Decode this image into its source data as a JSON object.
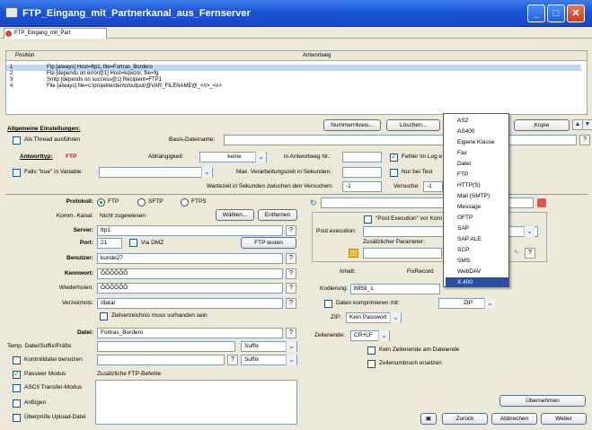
{
  "window": {
    "title": "FTP_Eingang_mit_Partnerkanal_aus_Fernserver",
    "tab": "FTP_Eingang_mit_Part"
  },
  "table": {
    "col_position": "Position",
    "col_antwortweg": "Antwortweg",
    "rows": [
      {
        "pos": "1",
        "text": "Ftp [always] Host=ftp1, file=Fortras_Bordero"
      },
      {
        "pos": "2",
        "text": "Ftp [depends on error@1] Host=kqwzor, file=fg"
      },
      {
        "pos": "3",
        "text": "Smtp [depends on success@1] Recipient=FTP1"
      },
      {
        "pos": "4",
        "text": "File [always] file=c:/projekte/demo/output/@VAR_FILENAME@_<n>_<n>"
      }
    ]
  },
  "toolbar": {
    "nummernkreis": "Nummernkreis...",
    "loeschen": "Löschen...",
    "kopie": "Kopie",
    "up": "▲",
    "down": "▼"
  },
  "allgemein": {
    "heading": "Allgemeine Einstellungen:",
    "thread": "Als Thread ausführen",
    "basis": "Basis-Dateiname:",
    "q": "?"
  },
  "antwort": {
    "label": "Antworttyp:",
    "value": "FTP",
    "abh_label": "Abhängigkeit:",
    "abh_value": "keine",
    "nr_label": "in Antwortweg Nr.:",
    "fehler": "Fehler im Log e",
    "falls": "Falls \"true\" in Variable:",
    "max_label": "Max. Verarbeitungszeit in Sekunden:",
    "nurtest": "Nur bei Test",
    "warte_label": "Wartezeit in Sekunden zwischen den Versuchen:",
    "warte_value": "-1",
    "versuche_label": "Versuche:",
    "versuche_value": "-1"
  },
  "ftp": {
    "protokoll": "Protokoll:",
    "ftp": "FTP",
    "sftp": "SFTP",
    "ftps": "FTPS",
    "kanal_label": "Komm.-Kanal:",
    "kanal_value": "Nicht zugewiesen",
    "waehlen": "Wählen...",
    "entfernen": "Entfernen",
    "server_label": "Server:",
    "server": "ftp1",
    "port_label": "Port:",
    "port": "21",
    "viadmz": "Via DMZ",
    "testen": "FTP testen",
    "benutzer_label": "Benutzer:",
    "benutzer": "kunde27",
    "kennwort_label": "Kennwort:",
    "kennwort": "ÕÕÕÕÕÕ",
    "wiederholen_label": "Wiederholen:",
    "wiederholen": "ÕÕÕÕÕÕ",
    "verz_label": "Verzeichnis:",
    "verz": "/data/",
    "zielverz": "Zielverzeichnis muss vorhanden sein",
    "datei_label": "Datei:",
    "datei": "Fortras_Bordero",
    "temp_label": "Temp. Datei/Suffix/Präfix:",
    "suffix1": "Suffix",
    "kontroll": "Kontrolldatei benutzen",
    "suffix2": "Suffix",
    "passiv": "Passiver Modus",
    "zusatz": "Zusätzliche FTP-Befehle",
    "ascii": "ASCII Transfer-Modus",
    "anfuegen": "Anfügen",
    "ueberpruefe": "Überprüfe Upload-Datei"
  },
  "right": {
    "postexec_cb": "\"Post Execution\" vor Kom",
    "postexec_label": "Post execution:",
    "zusatzparam": "Zusätzlicher Parameter:",
    "inhalt_label": "Inhalt:",
    "inhalt": "FixRecord",
    "kodierung_label": "Kodierung:",
    "kodierung": "8859_1",
    "komprimieren": "Daten komprimieren mit:",
    "zipfmt": "ZIP",
    "zip_label": "ZIP:",
    "zip": "Kein Passwort",
    "zeilenende_label": "Zeilenende:",
    "zeilenende": "CR+LF",
    "keinzeilenende": "Kein Zeilenende am Dateiende",
    "zeilenumbruch": "Zeilenumbruch ersetzen"
  },
  "menu": {
    "items": [
      "AS2",
      "AS400",
      "Eigene Klasse",
      "Fax",
      "Datei",
      "FTP",
      "HTTP(S)",
      "Mail (SMTP)",
      "Message",
      "OFTP",
      "SAP",
      "SAP ALE",
      "SCP",
      "SMS",
      "WebDAV",
      "X.400"
    ],
    "selected": "X.400"
  },
  "footer": {
    "uebernehmen": "Übernehmen",
    "zurueck": "Zurück",
    "abbrechen": "Abbrechen",
    "weiter": "Weiter"
  }
}
